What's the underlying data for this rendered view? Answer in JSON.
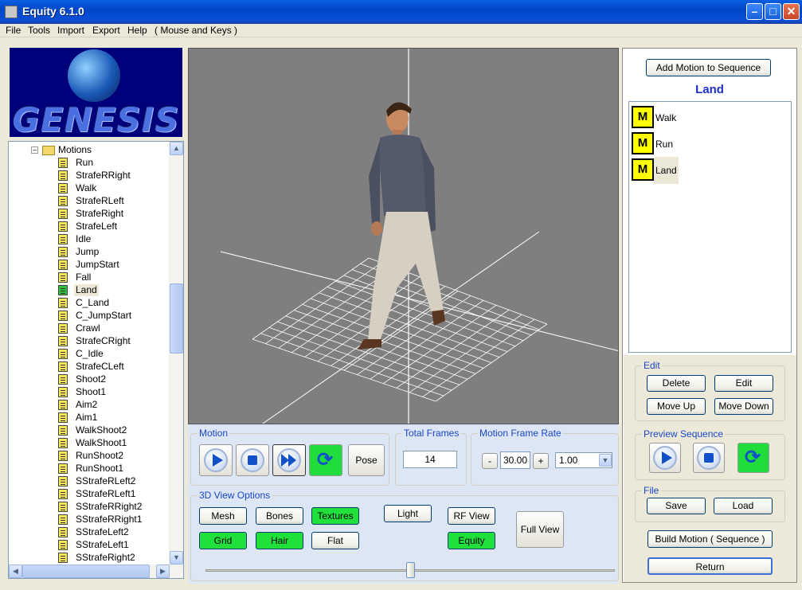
{
  "window": {
    "title": "Equity 6.1.0"
  },
  "menu": [
    "File",
    "Tools",
    "Import",
    "Export",
    "Help",
    "( Mouse and Keys )"
  ],
  "logo": {
    "text": "GENESIS"
  },
  "tree": {
    "root_label": "Motions",
    "items": [
      "Run",
      "StrafeRRight",
      "Walk",
      "StrafeRLeft",
      "StrafeRight",
      "StrafeLeft",
      "Idle",
      "Jump",
      "JumpStart",
      "Fall",
      "Land",
      "C_Land",
      "C_JumpStart",
      "Crawl",
      "StrafeCRight",
      "C_Idle",
      "StrafeCLeft",
      "Shoot2",
      "Shoot1",
      "Aim2",
      "Aim1",
      "WalkShoot2",
      "WalkShoot1",
      "RunShoot2",
      "RunShoot1",
      "SStrafeRLeft2",
      "SStrafeRLeft1",
      "SStrafeRRight2",
      "SStrafeRRight1",
      "SStrafeLeft2",
      "SStrafeLeft1",
      "SStrafeRight2"
    ],
    "selected": "Land"
  },
  "motion_group": {
    "title": "Motion",
    "pose": "Pose"
  },
  "total_frames": {
    "title": "Total Frames",
    "value": "14"
  },
  "frame_rate": {
    "title": "Motion Frame Rate",
    "minus": "-",
    "value": "30.00",
    "plus": "+",
    "speed": "1.00"
  },
  "view_options": {
    "title": "3D View Options",
    "mesh": "Mesh",
    "bones": "Bones",
    "textures": "Textures",
    "grid": "Grid",
    "hair": "Hair",
    "flat": "Flat",
    "light": "Light",
    "rf_view": "RF View",
    "equity": "Equity",
    "full_view": "Full View"
  },
  "slider": {
    "position": 0.5
  },
  "sequence": {
    "add_button": "Add Motion to Sequence",
    "current": "Land",
    "badge": "M",
    "items": [
      "Walk",
      "Run",
      "Land"
    ]
  },
  "edit": {
    "title": "Edit",
    "delete": "Delete",
    "edit": "Edit",
    "move_up": "Move Up",
    "move_down": "Move Down"
  },
  "preview": {
    "title": "Preview Sequence"
  },
  "file": {
    "title": "File",
    "save": "Save",
    "load": "Load"
  },
  "build_button": "Build Motion ( Sequence )",
  "return_button": "Return",
  "colors": {
    "accent": "#1a46c8",
    "active_green": "#21e03c",
    "badge_yellow": "#ffff00",
    "viewport_bg": "#7f7f7f"
  }
}
